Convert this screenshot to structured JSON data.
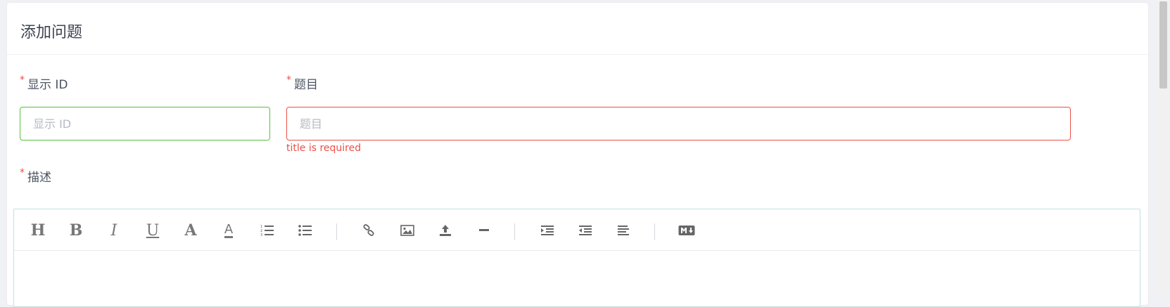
{
  "card": {
    "title": "添加问题"
  },
  "form": {
    "display_id": {
      "label": "显示 ID",
      "placeholder": "显示 ID",
      "required_mark": "*"
    },
    "title": {
      "label": "题目",
      "placeholder": "题目",
      "required_mark": "*",
      "error": "title is required"
    },
    "description": {
      "label": "描述",
      "required_mark": "*"
    }
  },
  "toolbar": {
    "heading_label": "H",
    "bold_label": "B",
    "italic_label": "I",
    "underline_label": "U",
    "font_label": "A",
    "font_color_label": "A",
    "icons": [
      "heading-icon",
      "bold-icon",
      "italic-icon",
      "underline-icon",
      "font-size-icon",
      "font-color-icon",
      "ordered-list-icon",
      "unordered-list-icon",
      "link-icon",
      "image-icon",
      "upload-icon",
      "horizontal-rule-icon",
      "indent-icon",
      "outdent-icon",
      "align-left-icon",
      "markdown-icon"
    ]
  },
  "colors": {
    "error": "#ed4f48",
    "success": "#56c23e",
    "editor_border": "#bfe1e0"
  }
}
